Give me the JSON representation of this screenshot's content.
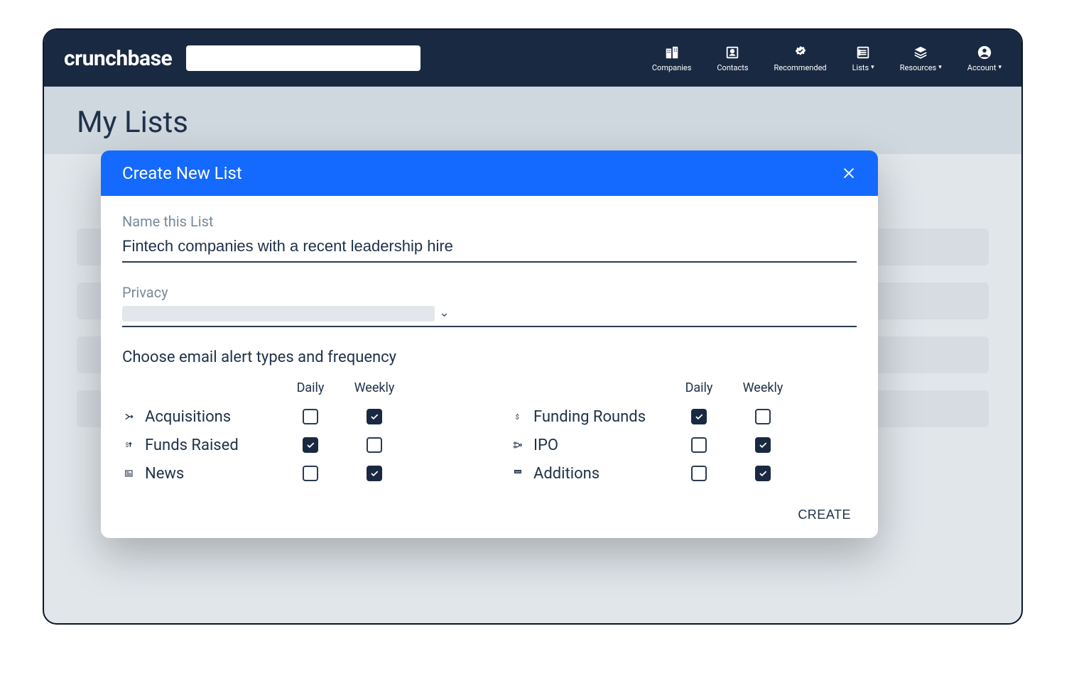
{
  "brand": "crunchbase",
  "nav": {
    "companies": "Companies",
    "contacts": "Contacts",
    "recommended": "Recommended",
    "lists": "Lists",
    "resources": "Resources",
    "account": "Account"
  },
  "page_title": "My Lists",
  "modal": {
    "title": "Create New List",
    "name_label": "Name this List",
    "name_value": "Fintech companies with a recent leadership hire",
    "privacy_label": "Privacy",
    "alerts_title": "Choose email alert types and frequency",
    "freq_daily": "Daily",
    "freq_weekly": "Weekly",
    "create_label": "CREATE",
    "left_alerts": [
      {
        "icon": "merge",
        "label": "Acquisitions",
        "daily": false,
        "weekly": true
      },
      {
        "icon": "dollar-up",
        "label": "Funds Raised",
        "daily": true,
        "weekly": false
      },
      {
        "icon": "news",
        "label": "News",
        "daily": false,
        "weekly": true
      }
    ],
    "right_alerts": [
      {
        "icon": "dollar",
        "label": "Funding Rounds",
        "daily": true,
        "weekly": false
      },
      {
        "icon": "ipo",
        "label": "IPO",
        "daily": false,
        "weekly": true
      },
      {
        "icon": "new",
        "label": "Additions",
        "daily": false,
        "weekly": true
      }
    ]
  }
}
